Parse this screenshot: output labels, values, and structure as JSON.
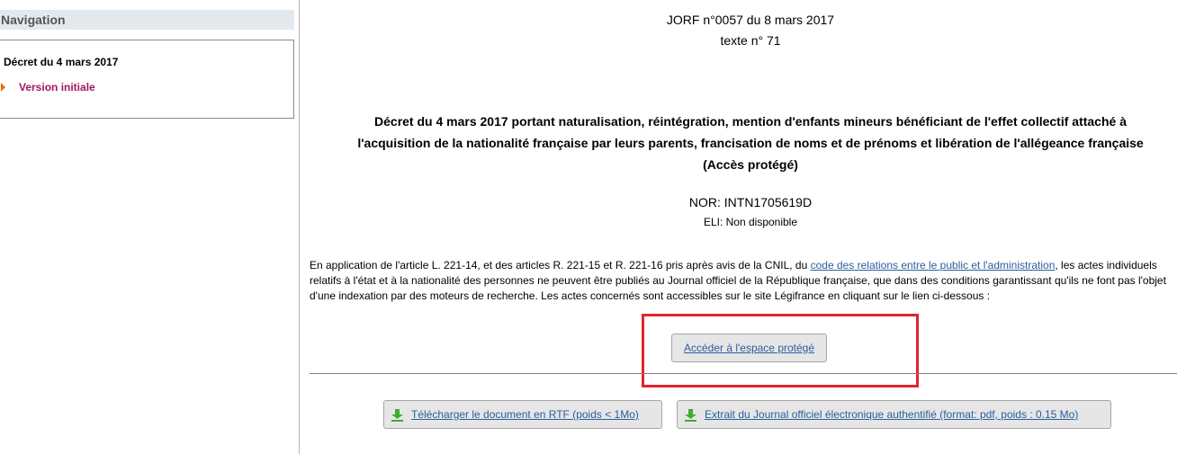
{
  "sidebar": {
    "header": "Navigation",
    "decree": "Décret du 4 mars 2017",
    "version": "Version initiale"
  },
  "main": {
    "jorf": "JORF n°0057 du 8 mars 2017",
    "texte": "texte n° 71",
    "title_line1": "Décret du 4 mars 2017 portant naturalisation, réintégration, mention d'enfants mineurs bénéficiant de l'effet collectif attaché à",
    "title_line2": "l'acquisition de la nationalité française par leurs parents, francisation de noms et de prénoms et libération de l'allégeance française",
    "title_line3": "(Accès protégé)",
    "nor": "NOR: INTN1705619D",
    "eli": "ELI: Non disponible",
    "para_before_link": "En application de l'article L. 221-14, et des articles R. 221-15 et R. 221-16 pris après avis de la CNIL, du ",
    "para_link": "code des relations entre le public et l'administration",
    "para_after_link": ", les actes individuels relatifs à l'état et à la nationalité des personnes ne peuvent être publiés au Journal officiel de la République française, que dans des conditions garantissant qu'ils ne font pas l'objet d'une indexation par des moteurs de recherche. Les actes concernés sont accessibles sur le site Légifrance en cliquant sur le lien ci-dessous :",
    "protected_button": "Accéder à l'espace protégé",
    "rtf_button": "Télécharger le document en RTF (poids < 1Mo)",
    "jo_button": "Extrait du Journal officiel électronique authentifié (format: pdf, poids : 0.15 Mo)"
  },
  "colors": {
    "highlight": "#e0262c",
    "link": "#2b5e9c",
    "version_link": "#a4145e",
    "nav_header_bg": "#e4e9ee",
    "download_icon": "#3eae2b"
  },
  "icons": {
    "nav_arrow": "triangle-right-icon",
    "download": "download-arrow-icon"
  }
}
